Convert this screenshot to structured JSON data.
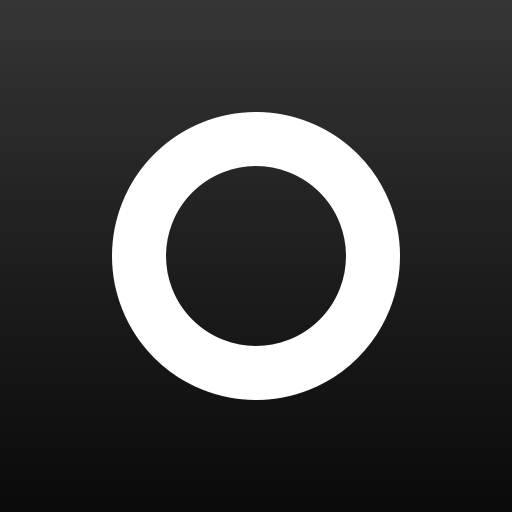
{
  "app": {
    "icon_name": "ring-logo-icon",
    "colors": {
      "background_top": "#353535",
      "background_bottom": "#0a0a0a",
      "ring": "#ffffff"
    }
  }
}
